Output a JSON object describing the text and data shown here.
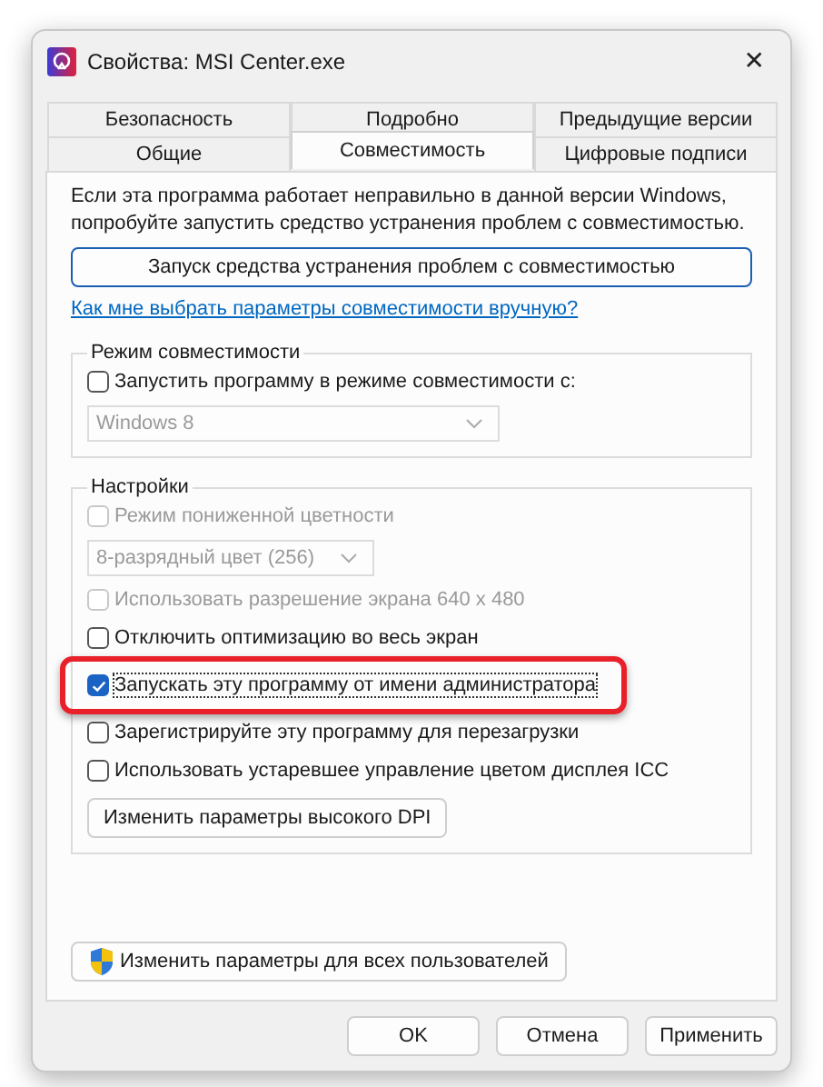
{
  "window": {
    "title": "Свойства: MSI Center.exe",
    "close": "✕"
  },
  "tabs": [
    [
      {
        "label": "Безопасность",
        "selected": false
      },
      {
        "label": "Подробно",
        "selected": false
      },
      {
        "label": "Предыдущие версии",
        "selected": false
      }
    ],
    [
      {
        "label": "Общие",
        "selected": false
      },
      {
        "label": "Совместимость",
        "selected": true
      },
      {
        "label": "Цифровые подписи",
        "selected": false
      }
    ]
  ],
  "intro": "Если эта программа работает неправильно в данной версии Windows, попробуйте запустить средство устранения проблем с совместимостью.",
  "troubleshoot_button": "Запуск средства устранения проблем с совместимостью",
  "help_link": "Как мне выбрать параметры совместимости вручную?",
  "compat_mode": {
    "legend": "Режим совместимости",
    "items": [
      {
        "kind": "checkbox",
        "label": "Запустить программу в режиме совместимости с:",
        "checked": false,
        "disabled": false,
        "highlighted": false
      },
      {
        "kind": "dropdown",
        "value": "Windows 8",
        "disabled": true
      }
    ]
  },
  "settings": {
    "legend": "Настройки",
    "items": [
      {
        "kind": "checkbox",
        "label": "Режим пониженной цветности",
        "checked": false,
        "disabled": true,
        "highlighted": false
      },
      {
        "kind": "dropdown",
        "value": "8-разрядный цвет (256)",
        "disabled": true
      },
      {
        "kind": "checkbox",
        "label": "Использовать разрешение экрана 640 x 480",
        "checked": false,
        "disabled": true,
        "highlighted": false
      },
      {
        "kind": "checkbox",
        "label": "Отключить оптимизацию во весь экран",
        "checked": false,
        "disabled": false,
        "highlighted": false
      },
      {
        "kind": "checkbox",
        "label": "Запускать эту программу от имени администратора",
        "checked": true,
        "disabled": false,
        "highlighted": true
      },
      {
        "kind": "checkbox",
        "label": "Зарегистрируйте эту программу для перезагрузки",
        "checked": false,
        "disabled": false,
        "highlighted": false
      },
      {
        "kind": "checkbox",
        "label": "Использовать устаревшее управление цветом дисплея ICC",
        "checked": false,
        "disabled": false,
        "highlighted": false
      },
      {
        "kind": "button",
        "label": "Изменить параметры высокого DPI"
      }
    ]
  },
  "all_users_button": "Изменить параметры для всех пользователей",
  "buttons": [
    "OK",
    "Отмена",
    "Применить"
  ]
}
